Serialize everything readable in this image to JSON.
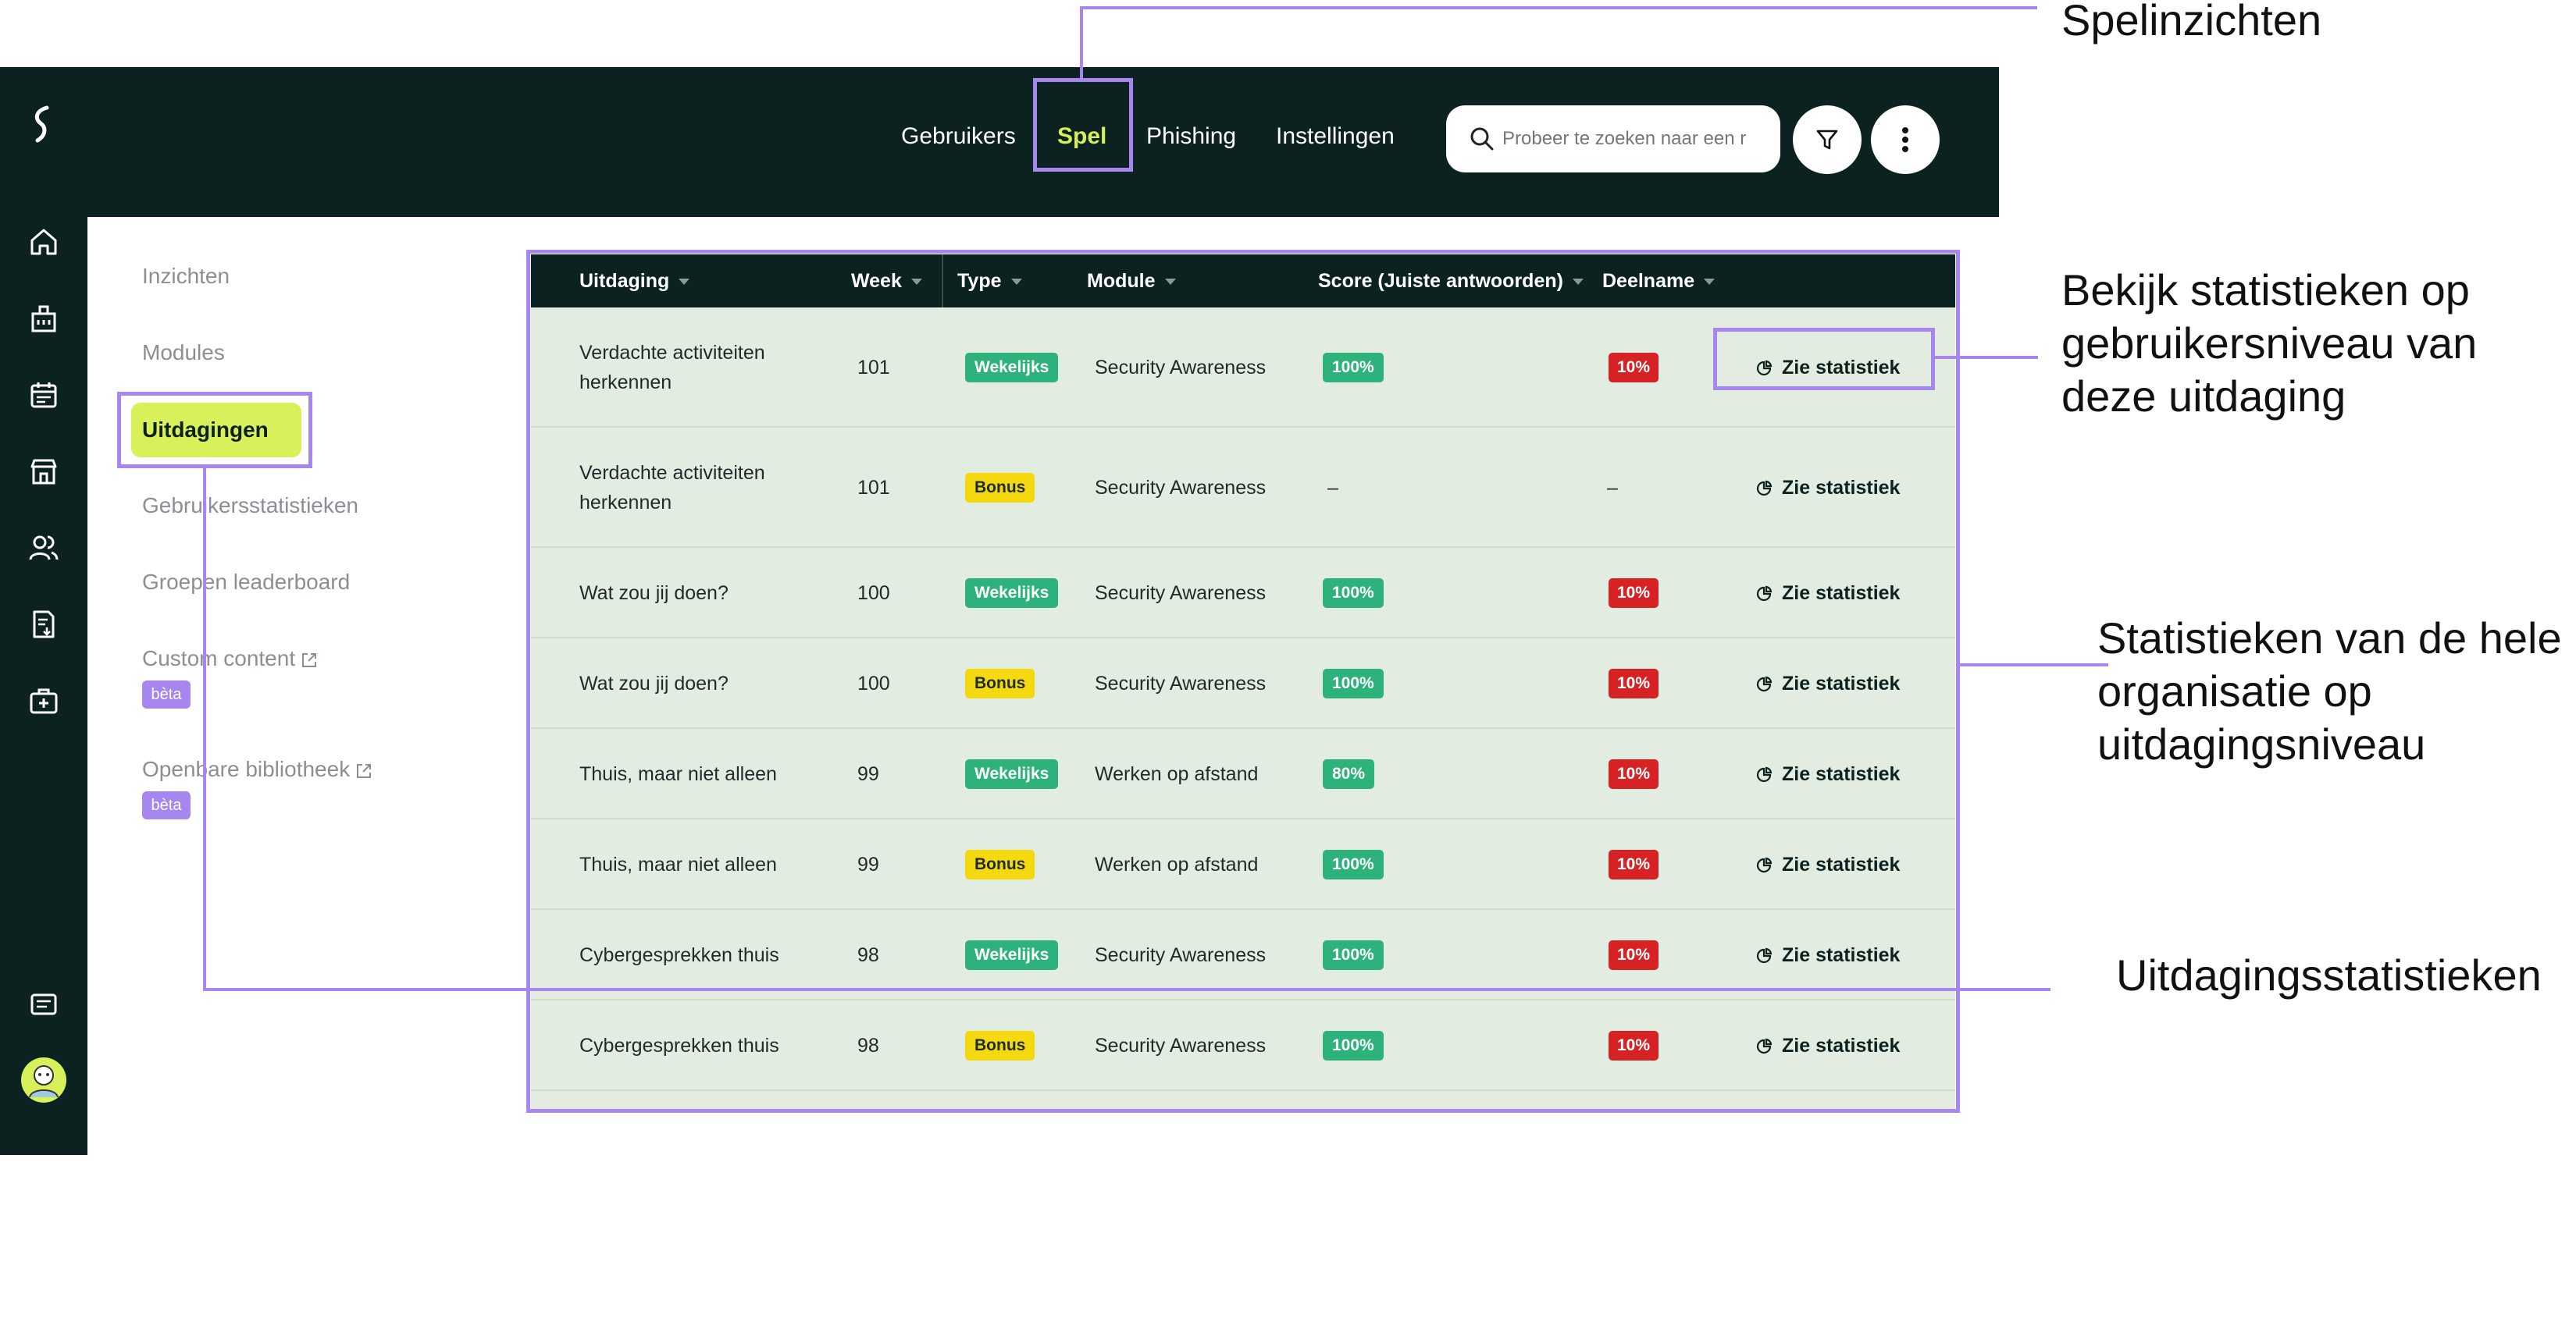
{
  "topnav": {
    "items": [
      "Gebruikers",
      "Spel",
      "Phishing",
      "Instellingen"
    ],
    "active": "Spel",
    "search_placeholder": "Probeer te zoeken naar een r"
  },
  "sidenav": {
    "items": [
      "Inzichten",
      "Modules",
      "Uitdagingen",
      "Gebruikersstatistieken",
      "Groepen leaderboard",
      "Custom content",
      "Openbare bibliotheek"
    ],
    "active": "Uitdagingen",
    "beta_label": "bèta"
  },
  "table": {
    "columns": [
      "Uitdaging",
      "Week",
      "Type",
      "Module",
      "Score (Juiste antwoorden)",
      "Deelname"
    ],
    "action_label": "Zie statistiek",
    "rows": [
      {
        "name": "Verdachte activiteiten herkennen",
        "week": "101",
        "type": "Wekelijks",
        "module": "Security Awareness",
        "score": "100%",
        "participation": "10%"
      },
      {
        "name": "Verdachte activiteiten herkennen",
        "week": "101",
        "type": "Bonus",
        "module": "Security Awareness",
        "score": "–",
        "participation": "–"
      },
      {
        "name": "Wat zou jij doen?",
        "week": "100",
        "type": "Wekelijks",
        "module": "Security Awareness",
        "score": "100%",
        "participation": "10%"
      },
      {
        "name": "Wat zou jij doen?",
        "week": "100",
        "type": "Bonus",
        "module": "Security Awareness",
        "score": "100%",
        "participation": "10%"
      },
      {
        "name": "Thuis, maar niet alleen",
        "week": "99",
        "type": "Wekelijks",
        "module": "Werken op afstand",
        "score": "80%",
        "participation": "10%"
      },
      {
        "name": "Thuis, maar niet alleen",
        "week": "99",
        "type": "Bonus",
        "module": "Werken op afstand",
        "score": "100%",
        "participation": "10%"
      },
      {
        "name": "Cybergesprekken thuis",
        "week": "98",
        "type": "Wekelijks",
        "module": "Security Awareness",
        "score": "100%",
        "participation": "10%"
      },
      {
        "name": "Cybergesprekken thuis",
        "week": "98",
        "type": "Bonus",
        "module": "Security Awareness",
        "score": "100%",
        "participation": "10%"
      }
    ]
  },
  "annotations": {
    "spelinzichten": "Spelinzichten",
    "user_stats": "Bekijk statistieken op gebruikersniveau van deze uitdaging",
    "org_stats": "Statistieken van de hele organisatie op uitdagingsniveau",
    "challenge_stats": "Uitdagingsstatistieken"
  },
  "colors": {
    "dark": "#0c2220",
    "accent": "#d8f05a",
    "callout": "#a886f0",
    "weekly": "#2db37a",
    "bonus": "#f4d90f",
    "participation": "#d62224",
    "table_bg": "#e3ece0"
  }
}
